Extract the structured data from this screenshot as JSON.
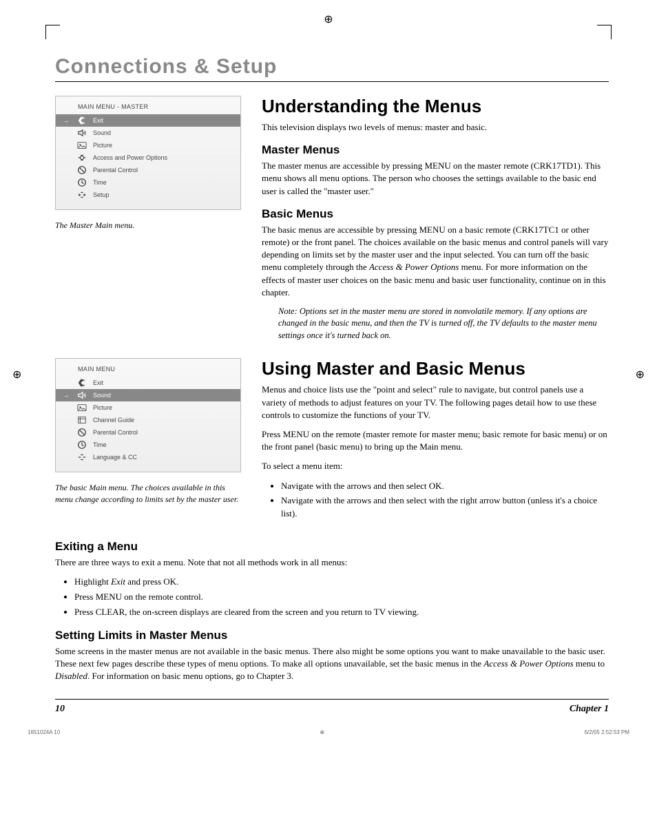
{
  "crop_glyph": "⊕",
  "section_title": "Connections & Setup",
  "menu_master": {
    "title": "MAIN MENU - MASTER",
    "items": [
      {
        "label": "Exit",
        "selected": true,
        "arrow": true
      },
      {
        "label": "Sound"
      },
      {
        "label": "Picture"
      },
      {
        "label": "Access and Power Options"
      },
      {
        "label": "Parental Control"
      },
      {
        "label": "Time"
      },
      {
        "label": "Setup"
      }
    ],
    "caption": "The Master Main menu."
  },
  "menu_basic": {
    "title": "MAIN MENU",
    "items": [
      {
        "label": "Exit"
      },
      {
        "label": "Sound",
        "selected": true,
        "arrow": true
      },
      {
        "label": "Picture"
      },
      {
        "label": "Channel Guide"
      },
      {
        "label": "Parental Control"
      },
      {
        "label": "Time"
      },
      {
        "label": "Language & CC"
      }
    ],
    "caption": "The basic Main menu. The choices available in this menu change according to limits set by the master user."
  },
  "h1a": "Understanding the Menus",
  "p_intro": "This television displays two levels of menus: master and basic.",
  "h2_master": "Master Menus",
  "p_master": "The master menus are accessible by pressing MENU on the master remote (CRK17TD1). This menu shows all menu options. The person who chooses the settings available to the basic end user is called the \"master user.\"",
  "h2_basic": "Basic Menus",
  "p_basic": "The basic menus are accessible by pressing MENU on a basic remote (CRK17TC1 or other remote) or the front panel. The choices available on the basic menus and control panels will vary depending on limits set by the master user and the input selected. You can turn off the basic menu completely through the ",
  "p_basic_italic": "Access & Power Options",
  "p_basic_2": " menu. For more information on the effects of master user choices on the basic menu and basic user functionality, continue on in this chapter.",
  "note": "Note: Options set in the master menu are stored in nonvolatile memory. If any options are changed in the basic menu, and then the TV is turned off, the TV defaults to the master menu settings once it's turned back on.",
  "h1b": "Using Master and Basic Menus",
  "p_using1": "Menus and choice lists use the \"point and select\" rule to navigate, but control panels use a variety of methods to adjust features on your TV. The following pages detail how to use these controls to customize the functions of your TV.",
  "p_using2": "Press MENU on the remote (master remote for master menu; basic remote for basic menu) or on the front panel (basic menu) to bring up the Main menu.",
  "p_using3": "To select a menu item:",
  "using_list": [
    "Navigate with the arrows and then select OK.",
    "Navigate with the arrows and then select with the right arrow button (unless it's a choice list)."
  ],
  "h2_exit": "Exiting a Menu",
  "p_exit": "There are three ways to exit a menu. Note that not all methods work in all menus:",
  "exit_list_1a": "Highlight ",
  "exit_list_1b": "Exit",
  "exit_list_1c": " and press OK.",
  "exit_list_2": "Press MENU on the remote control.",
  "exit_list_3": "Press CLEAR, the on-screen displays are cleared from the screen and you return to TV viewing.",
  "h2_limits": "Setting Limits in Master Menus",
  "p_limits_1": "Some screens in the master menus are not available in the basic menus. There also might be some options you want to make unavailable to the basic user. These next few pages describe these types of menu options. To make all options unavailable, set the basic menus in the ",
  "p_limits_italic1": "Access & Power Options",
  "p_limits_2": " menu to ",
  "p_limits_italic2": "Disabled",
  "p_limits_3": ". For information on basic menu options, go to Chapter 3.",
  "footer_page": "10",
  "footer_chapter": "Chapter 1",
  "print_left": "1651024A   10",
  "print_right": "6/2/05   2:52:53 PM"
}
